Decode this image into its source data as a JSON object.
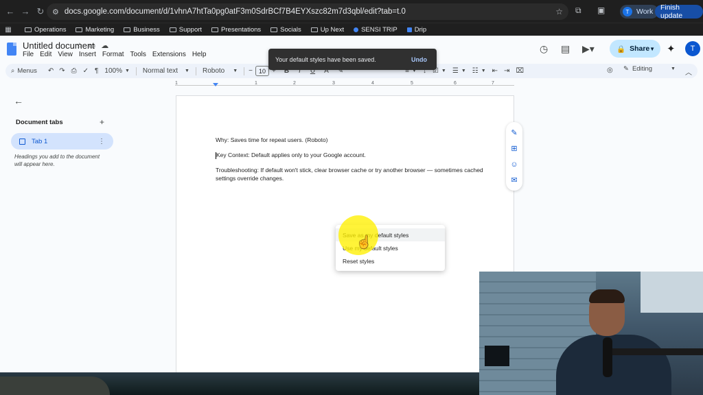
{
  "browser": {
    "url": "docs.google.com/document/d/1vhnA7htTa0pg0atF3m0SdrBCf7B4EYXszc82m7d3qbl/edit?tab=t.0",
    "profile_initial": "T",
    "profile_label": "Work",
    "update_label": "Finish update",
    "bookmarks": [
      {
        "label": "Operations",
        "kind": "folder"
      },
      {
        "label": "Marketing",
        "kind": "folder"
      },
      {
        "label": "Business",
        "kind": "folder"
      },
      {
        "label": "Support",
        "kind": "folder"
      },
      {
        "label": "Presentations",
        "kind": "folder"
      },
      {
        "label": "Socials",
        "kind": "folder"
      },
      {
        "label": "Up Next",
        "kind": "folder"
      },
      {
        "label": "SENSI TRIP",
        "kind": "site"
      },
      {
        "label": "Drip",
        "kind": "site"
      }
    ]
  },
  "docs": {
    "title": "Untitled document",
    "menu": [
      "File",
      "Edit",
      "View",
      "Insert",
      "Format",
      "Tools",
      "Extensions",
      "Help"
    ],
    "share_label": "Share",
    "avatar_initial": "T"
  },
  "toast": {
    "message": "Your default styles have been saved.",
    "action": "Undo"
  },
  "toolbar": {
    "menus_label": "Menus",
    "zoom": "100%",
    "style": "Normal text",
    "font": "Roboto",
    "font_size": "10",
    "mode": "Editing"
  },
  "ruler": {
    "numbers": [
      "1",
      "1",
      "2",
      "3",
      "4",
      "5",
      "6",
      "7"
    ]
  },
  "sidebar": {
    "section_label": "Document tabs",
    "tab_label": "Tab 1",
    "hint": "Headings you add to the document will appear here."
  },
  "document": {
    "paragraphs": [
      "Why: Saves time for repeat users. (Roboto)",
      "Key Context: Default applies only to your Google account.",
      "Troubleshooting: If default won't stick, clear browser cache or try another browser — sometimes cached settings override changes."
    ]
  },
  "context_menu": {
    "items": [
      "Save as my default styles",
      "Use my default styles",
      "Reset styles"
    ]
  }
}
